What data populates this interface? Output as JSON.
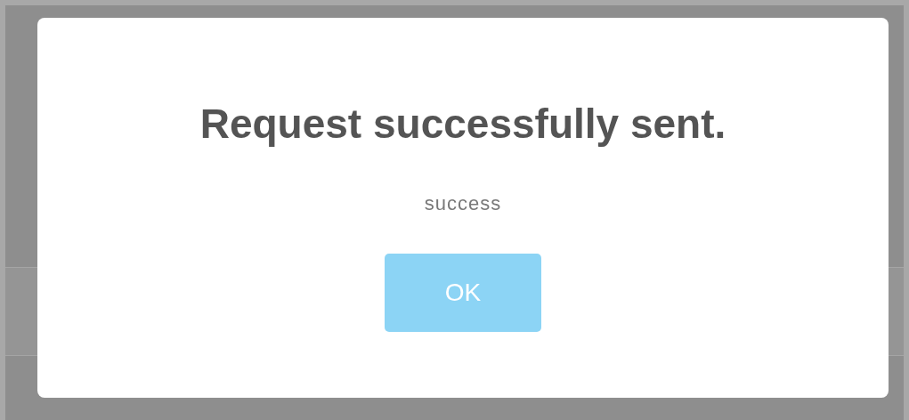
{
  "dialog": {
    "title": "Request successfully sent.",
    "message": "success",
    "buttons": [
      {
        "label": "OK"
      }
    ]
  }
}
